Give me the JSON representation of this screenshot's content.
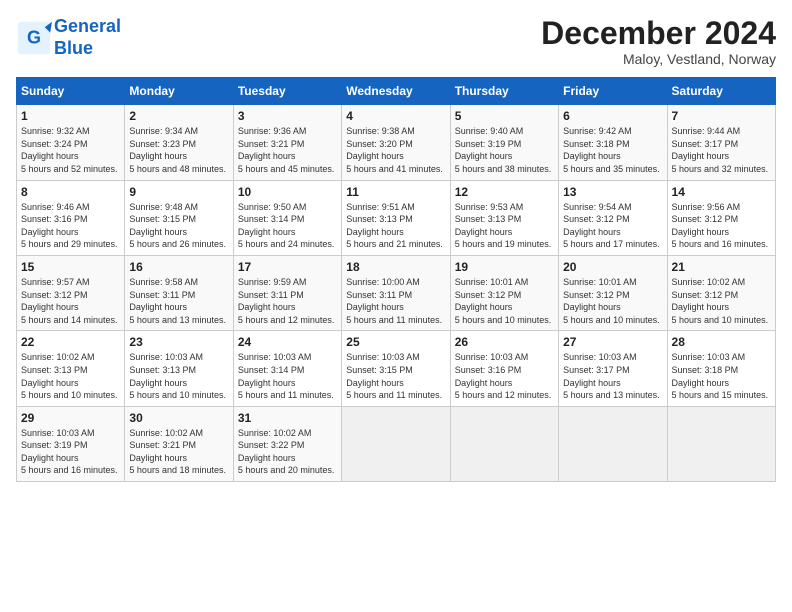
{
  "header": {
    "logo_line1": "General",
    "logo_line2": "Blue",
    "month": "December 2024",
    "location": "Maloy, Vestland, Norway"
  },
  "weekdays": [
    "Sunday",
    "Monday",
    "Tuesday",
    "Wednesday",
    "Thursday",
    "Friday",
    "Saturday"
  ],
  "weeks": [
    [
      {
        "day": "1",
        "sunrise": "9:32 AM",
        "sunset": "3:24 PM",
        "daylight": "5 hours and 52 minutes."
      },
      {
        "day": "2",
        "sunrise": "9:34 AM",
        "sunset": "3:23 PM",
        "daylight": "5 hours and 48 minutes."
      },
      {
        "day": "3",
        "sunrise": "9:36 AM",
        "sunset": "3:21 PM",
        "daylight": "5 hours and 45 minutes."
      },
      {
        "day": "4",
        "sunrise": "9:38 AM",
        "sunset": "3:20 PM",
        "daylight": "5 hours and 41 minutes."
      },
      {
        "day": "5",
        "sunrise": "9:40 AM",
        "sunset": "3:19 PM",
        "daylight": "5 hours and 38 minutes."
      },
      {
        "day": "6",
        "sunrise": "9:42 AM",
        "sunset": "3:18 PM",
        "daylight": "5 hours and 35 minutes."
      },
      {
        "day": "7",
        "sunrise": "9:44 AM",
        "sunset": "3:17 PM",
        "daylight": "5 hours and 32 minutes."
      }
    ],
    [
      {
        "day": "8",
        "sunrise": "9:46 AM",
        "sunset": "3:16 PM",
        "daylight": "5 hours and 29 minutes."
      },
      {
        "day": "9",
        "sunrise": "9:48 AM",
        "sunset": "3:15 PM",
        "daylight": "5 hours and 26 minutes."
      },
      {
        "day": "10",
        "sunrise": "9:50 AM",
        "sunset": "3:14 PM",
        "daylight": "5 hours and 24 minutes."
      },
      {
        "day": "11",
        "sunrise": "9:51 AM",
        "sunset": "3:13 PM",
        "daylight": "5 hours and 21 minutes."
      },
      {
        "day": "12",
        "sunrise": "9:53 AM",
        "sunset": "3:13 PM",
        "daylight": "5 hours and 19 minutes."
      },
      {
        "day": "13",
        "sunrise": "9:54 AM",
        "sunset": "3:12 PM",
        "daylight": "5 hours and 17 minutes."
      },
      {
        "day": "14",
        "sunrise": "9:56 AM",
        "sunset": "3:12 PM",
        "daylight": "5 hours and 16 minutes."
      }
    ],
    [
      {
        "day": "15",
        "sunrise": "9:57 AM",
        "sunset": "3:12 PM",
        "daylight": "5 hours and 14 minutes."
      },
      {
        "day": "16",
        "sunrise": "9:58 AM",
        "sunset": "3:11 PM",
        "daylight": "5 hours and 13 minutes."
      },
      {
        "day": "17",
        "sunrise": "9:59 AM",
        "sunset": "3:11 PM",
        "daylight": "5 hours and 12 minutes."
      },
      {
        "day": "18",
        "sunrise": "10:00 AM",
        "sunset": "3:11 PM",
        "daylight": "5 hours and 11 minutes."
      },
      {
        "day": "19",
        "sunrise": "10:01 AM",
        "sunset": "3:12 PM",
        "daylight": "5 hours and 10 minutes."
      },
      {
        "day": "20",
        "sunrise": "10:01 AM",
        "sunset": "3:12 PM",
        "daylight": "5 hours and 10 minutes."
      },
      {
        "day": "21",
        "sunrise": "10:02 AM",
        "sunset": "3:12 PM",
        "daylight": "5 hours and 10 minutes."
      }
    ],
    [
      {
        "day": "22",
        "sunrise": "10:02 AM",
        "sunset": "3:13 PM",
        "daylight": "5 hours and 10 minutes."
      },
      {
        "day": "23",
        "sunrise": "10:03 AM",
        "sunset": "3:13 PM",
        "daylight": "5 hours and 10 minutes."
      },
      {
        "day": "24",
        "sunrise": "10:03 AM",
        "sunset": "3:14 PM",
        "daylight": "5 hours and 11 minutes."
      },
      {
        "day": "25",
        "sunrise": "10:03 AM",
        "sunset": "3:15 PM",
        "daylight": "5 hours and 11 minutes."
      },
      {
        "day": "26",
        "sunrise": "10:03 AM",
        "sunset": "3:16 PM",
        "daylight": "5 hours and 12 minutes."
      },
      {
        "day": "27",
        "sunrise": "10:03 AM",
        "sunset": "3:17 PM",
        "daylight": "5 hours and 13 minutes."
      },
      {
        "day": "28",
        "sunrise": "10:03 AM",
        "sunset": "3:18 PM",
        "daylight": "5 hours and 15 minutes."
      }
    ],
    [
      {
        "day": "29",
        "sunrise": "10:03 AM",
        "sunset": "3:19 PM",
        "daylight": "5 hours and 16 minutes."
      },
      {
        "day": "30",
        "sunrise": "10:02 AM",
        "sunset": "3:21 PM",
        "daylight": "5 hours and 18 minutes."
      },
      {
        "day": "31",
        "sunrise": "10:02 AM",
        "sunset": "3:22 PM",
        "daylight": "5 hours and 20 minutes."
      },
      null,
      null,
      null,
      null
    ]
  ]
}
